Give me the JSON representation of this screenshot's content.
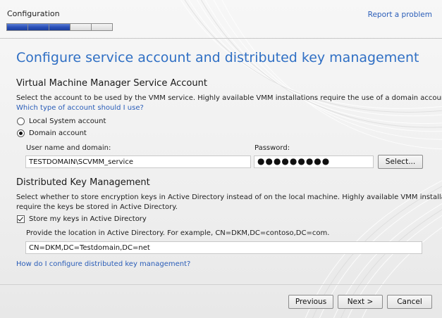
{
  "header": {
    "step_name": "Configuration",
    "report_link": "Report a problem",
    "progress": {
      "segments_total": 5,
      "segments_completed": 3
    }
  },
  "page_title": "Configure service account and distributed key management",
  "vmm_account": {
    "title": "Virtual Machine Manager Service Account",
    "description": "Select the account to be used by the VMM service. Highly available VMM installations require the use of a domain account.",
    "help_link": "Which type of account should I use?",
    "options": [
      {
        "label": "Local System account",
        "selected": false
      },
      {
        "label": "Domain account",
        "selected": true
      }
    ],
    "username_label": "User name and domain:",
    "username_value": "TESTDOMAIN\\SCVMM_service",
    "password_label": "Password:",
    "password_value": "●●●●●●●●●",
    "select_button": "Select..."
  },
  "dkm": {
    "title": "Distributed Key Management",
    "description_lines": [
      "Select whether to store encryption keys in Active Directory instead of on the local machine. Highly available VMM installations",
      "require the keys be stored in Active Directory."
    ],
    "store_checkbox_label": "Store my keys in Active Directory",
    "store_checked": true,
    "location_label": "Provide the location in Active Directory. For example, CN=DKM,DC=contoso,DC=com.",
    "location_value": "CN=DKM,DC=Testdomain,DC=net",
    "help_link": "How do I configure distributed key management?"
  },
  "footer": {
    "previous_button": "Previous",
    "next_button": "Next >",
    "cancel_button": "Cancel"
  },
  "colors": {
    "accent": "#2f6fc4",
    "link": "#2a5db8",
    "progress_fill": "#2a4fb8"
  }
}
